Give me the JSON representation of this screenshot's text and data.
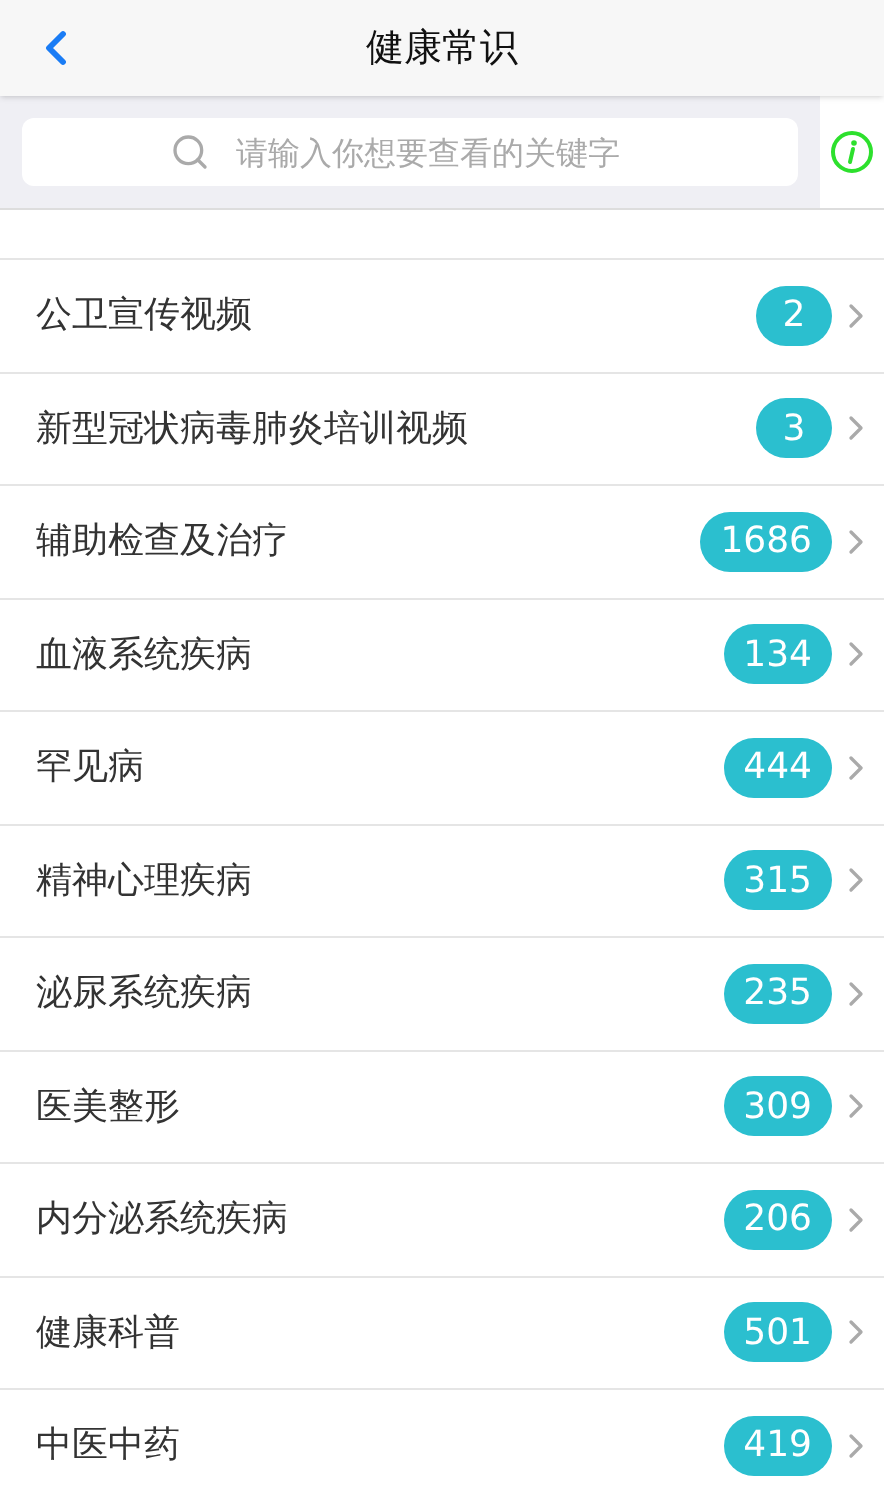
{
  "header": {
    "title": "健康常识"
  },
  "search": {
    "placeholder": "请输入你想要查看的关键字"
  },
  "categories": [
    {
      "name": "公卫宣传视频",
      "count": "2"
    },
    {
      "name": "新型冠状病毒肺炎培训视频",
      "count": "3"
    },
    {
      "name": "辅助检查及治疗",
      "count": "1686"
    },
    {
      "name": "血液系统疾病",
      "count": "134"
    },
    {
      "name": "罕见病",
      "count": "444"
    },
    {
      "name": "精神心理疾病",
      "count": "315"
    },
    {
      "name": "泌尿系统疾病",
      "count": "235"
    },
    {
      "name": "医美整形",
      "count": "309"
    },
    {
      "name": "内分泌系统疾病",
      "count": "206"
    },
    {
      "name": "健康科普",
      "count": "501"
    },
    {
      "name": "中医中药",
      "count": "419"
    }
  ]
}
